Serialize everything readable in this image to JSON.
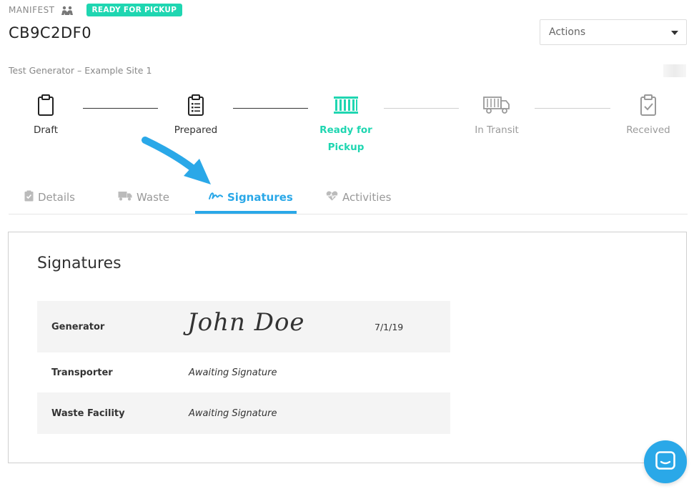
{
  "header": {
    "manifest_label": "MANIFEST",
    "status_badge": "READY FOR PICKUP",
    "manifest_id": "CB9C2DF0",
    "site_name": "Test Generator – Example Site 1"
  },
  "actions": {
    "label": "Actions",
    "caret_icon": "caret-down-icon"
  },
  "steps": [
    {
      "label": "Draft",
      "icon": "clipboard-icon",
      "state": "done"
    },
    {
      "label": "Prepared",
      "icon": "checklist-icon",
      "state": "done"
    },
    {
      "label": "Ready for Pickup",
      "icon": "container-icon",
      "state": "active"
    },
    {
      "label": "In Transit",
      "icon": "truck-icon",
      "state": "future"
    },
    {
      "label": "Received",
      "icon": "clipboard-check-icon",
      "state": "future"
    }
  ],
  "tabs": [
    {
      "label": "Details",
      "icon": "clipboard-check-icon",
      "active": false
    },
    {
      "label": "Waste",
      "icon": "truck-icon",
      "active": false
    },
    {
      "label": "Signatures",
      "icon": "signature-icon",
      "active": true
    },
    {
      "label": "Activities",
      "icon": "heartbeat-icon",
      "active": false
    }
  ],
  "panel": {
    "title": "Signatures",
    "rows": [
      {
        "role": "Generator",
        "signature": "John Doe",
        "date": "7/1/19"
      },
      {
        "role": "Transporter",
        "value": "Awaiting Signature"
      },
      {
        "role": "Waste Facility",
        "value": "Awaiting Signature"
      }
    ]
  },
  "colors": {
    "accent_teal": "#1fd6b1",
    "accent_blue": "#2aa8e8"
  }
}
